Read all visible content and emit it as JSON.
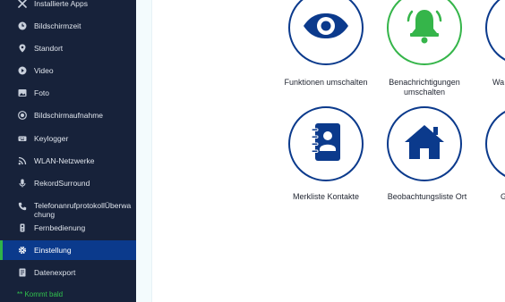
{
  "sidebar": {
    "items": [
      {
        "label": "Installierte Apps",
        "icon": "wrench-icon"
      },
      {
        "label": "Bildschirmzeit",
        "icon": "clock-icon"
      },
      {
        "label": "Standort",
        "icon": "location-pin-icon"
      },
      {
        "label": "Video",
        "icon": "play-icon"
      },
      {
        "label": "Foto",
        "icon": "image-icon"
      },
      {
        "label": "Bildschirmaufnahme",
        "icon": "record-icon"
      },
      {
        "label": "Keylogger",
        "icon": "keyboard-icon"
      },
      {
        "label": "WLAN-Netzwerke",
        "icon": "wifi-icon"
      },
      {
        "label": "RekordSurround",
        "icon": "microphone-icon"
      },
      {
        "label": "TelefonanrufprotokollÜberwachung",
        "icon": "phone-icon"
      },
      {
        "label": "Fernbedienung",
        "icon": "remote-icon"
      },
      {
        "label": "Einstellung",
        "icon": "gear-icon",
        "active": true
      },
      {
        "label": "Datenexport",
        "icon": "export-icon"
      }
    ],
    "coming_soon": "** Kommt bald"
  },
  "tiles": [
    {
      "label": "Funktionen umschalten",
      "icon": "eye-icon"
    },
    {
      "label": "Benachrichtigungen umschalten",
      "icon": "bell-icon"
    },
    {
      "label": "Wa",
      "icon": "partial-icon"
    },
    {
      "label": "Merkliste Kontakte",
      "icon": "contact-book-icon"
    },
    {
      "label": "Beobachtungsliste Ort",
      "icon": "house-icon"
    },
    {
      "label": "G",
      "icon": "partial-icon"
    }
  ],
  "colors": {
    "sidebar_bg": "#17223a",
    "active_bg": "#0b3a8c",
    "accent_green": "#35b54a",
    "icon_blue": "#0b3a8c"
  }
}
